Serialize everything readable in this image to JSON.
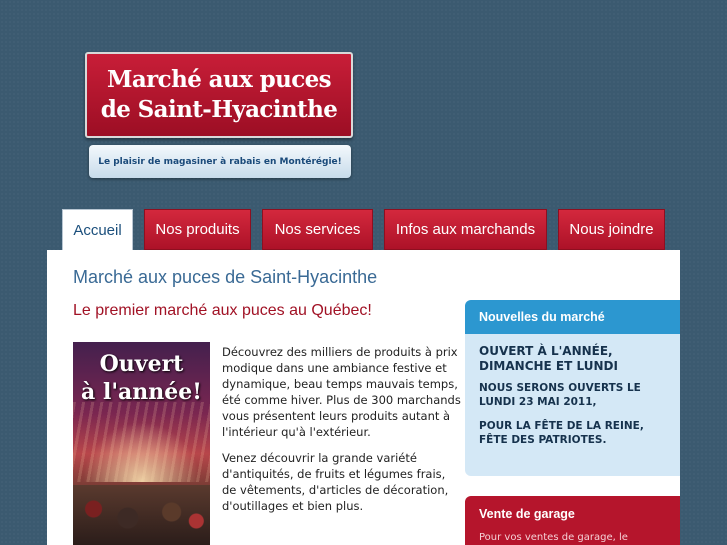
{
  "logo": {
    "line1": "Marché aux puces",
    "line2": "de Saint-Hyacinthe"
  },
  "tagline": "Le plaisir de magasiner à rabais en Montérégie!",
  "nav": {
    "tabs": [
      {
        "label": "Accueil",
        "active": true
      },
      {
        "label": "Nos produits",
        "active": false
      },
      {
        "label": "Nos services",
        "active": false
      },
      {
        "label": "Infos aux marchands",
        "active": false
      },
      {
        "label": "Nous joindre",
        "active": false
      }
    ]
  },
  "main": {
    "title": "Marché aux puces de Saint-Hyacinthe",
    "subtitle": "Le premier marché aux puces au Québec!",
    "poster_line1": "Ouvert",
    "poster_line2": "à l'année!",
    "paragraphs": [
      "Découvrez des milliers de produits à prix modique dans une ambiance festive et dynamique, beau temps mauvais temps, été comme hiver. Plus de 300 marchands vous présentent leurs produits autant à l'intérieur qu'à l'extérieur.",
      "Venez découvrir la grande variété d'antiquités, de fruits et légumes frais, de vêtements, d'articles de décoration, d'outillages et bien plus."
    ]
  },
  "news": {
    "header": "Nouvelles du marché",
    "title": "OUVERT À L'ANNÉE, DIMANCHE ET LUNDI",
    "p1": "NOUS SERONS OUVERTS LE LUNDI 23 MAI 2011,",
    "p2": "POUR LA FÊTE DE LA REINE, FÊTE DES PATRIOTES."
  },
  "garage": {
    "header": "Vente de garage",
    "text": "Pour vos ventes de garage, le"
  },
  "colors": {
    "background": "#3b5a70",
    "accent_red": "#b5152c",
    "accent_blue": "#2c97d0",
    "title_blue": "#3a6a95"
  }
}
